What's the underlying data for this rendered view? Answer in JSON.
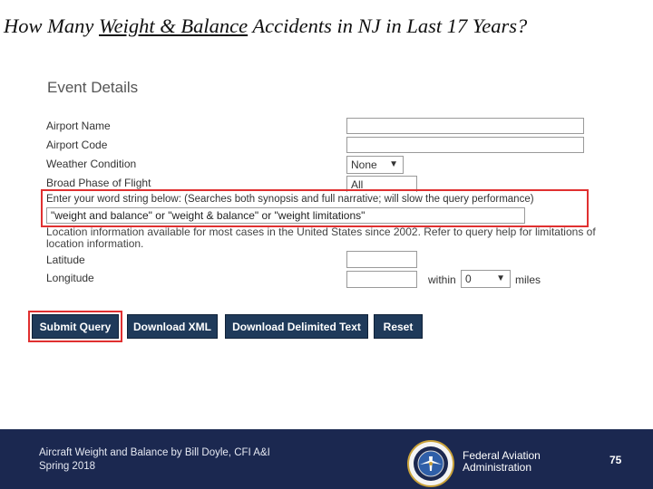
{
  "slide_title": {
    "pre": "How Many ",
    "underlined": "Weight & Balance",
    "post": " Accidents in NJ in Last 17 Years?"
  },
  "form": {
    "heading": "Event Details",
    "airport_name_label": "Airport Name",
    "airport_code_label": "Airport Code",
    "weather_label": "Weather Condition",
    "weather_value": "None",
    "phase_label": "Broad Phase of Flight",
    "phase_value": "All",
    "word_string_label": "Enter your word string below: (Searches both synopsis and full narrative; will slow the query performance)",
    "word_string_value": "\"weight and balance\" or \"weight & balance\" or \"weight limitations\"",
    "location_note_1": "Location information available for most cases in the United States since 2002. Refer to query help for limitations of",
    "location_note_2": "location information.",
    "latitude_label": "Latitude",
    "longitude_label": "Longitude",
    "within_label": "within",
    "within_value": "0",
    "miles_label": "miles"
  },
  "buttons": {
    "submit": "Submit Query",
    "download_xml": "Download XML",
    "download_delimited": "Download Delimited Text",
    "reset": "Reset"
  },
  "footer": {
    "line1": "Aircraft Weight and Balance by Bill Doyle, CFI A&I",
    "line2": "Spring 2018",
    "faa_line1": "Federal Aviation",
    "faa_line2": "Administration",
    "page_number": "75"
  },
  "icons": {
    "dropdown": "triangle-down-icon",
    "seal": "faa-seal-icon"
  },
  "colors": {
    "highlight": "#e03030",
    "button_bg": "#1f3a5a",
    "footer_bg": "#1b2850"
  }
}
